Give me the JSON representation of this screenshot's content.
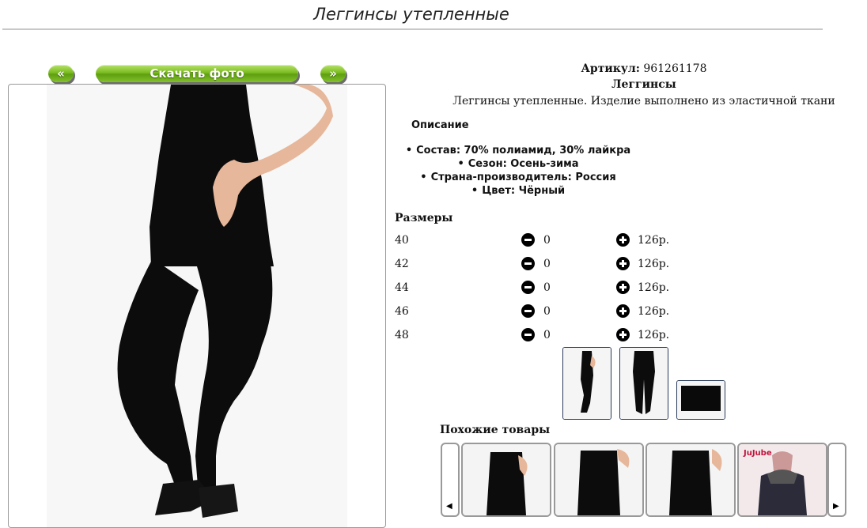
{
  "page": {
    "title": "Леггинсы утепленные"
  },
  "photo_nav": {
    "prev_label": "«",
    "download_label": "Скачать фото",
    "next_label": "»"
  },
  "product": {
    "article_label": "Артикул:",
    "article_value": "961261178",
    "name": "Леггинсы",
    "short_description": "Леггинсы утепленные. Изделие выполнено из эластичной ткани",
    "description_heading": "Описание",
    "description_items": [
      "Состав: 70% полиамид, 30% лайкра",
      "Сезон: Осень-зима",
      "Страна-производитель: Россия",
      "Цвет: Чёрный"
    ]
  },
  "sizes": {
    "heading": "Размеры",
    "rows": [
      {
        "size": "40",
        "qty": "0",
        "price": "126р."
      },
      {
        "size": "42",
        "qty": "0",
        "price": "126р."
      },
      {
        "size": "44",
        "qty": "0",
        "price": "126р."
      },
      {
        "size": "46",
        "qty": "0",
        "price": "126р."
      },
      {
        "size": "48",
        "qty": "0",
        "price": "126р."
      }
    ]
  },
  "similar": {
    "heading": "Похожие товары",
    "brand_text": "JuJube"
  },
  "icons": {
    "minus": "minus-circle-icon",
    "plus": "plus-circle-icon"
  },
  "colors": {
    "button_green": "#7cbc22",
    "thumb_border": "#2a3c5a"
  }
}
